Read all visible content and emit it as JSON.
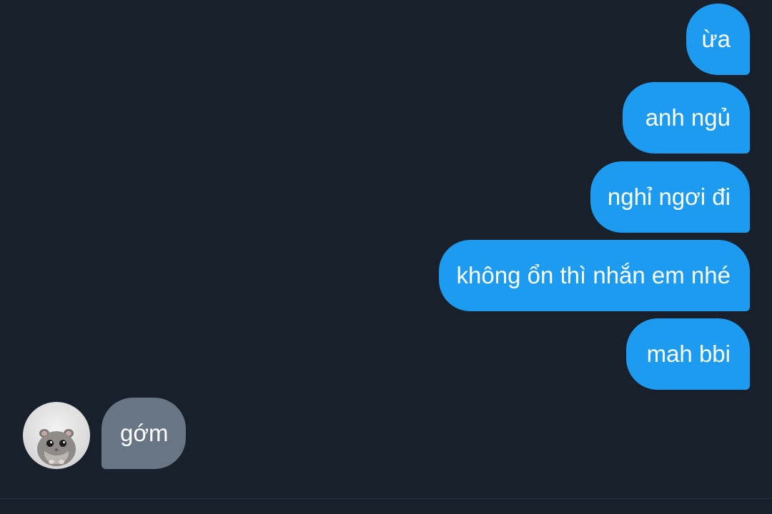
{
  "conversation": {
    "outgoing": [
      {
        "text": "ừa"
      },
      {
        "text": "anh ngủ"
      },
      {
        "text": "nghỉ ngơi đi"
      },
      {
        "text": "không ổn thì nhắn em nhé"
      },
      {
        "text": "mah bbi"
      }
    ],
    "incoming": [
      {
        "text": "gớm"
      }
    ]
  },
  "colors": {
    "background": "#18202b",
    "outgoing_bubble": "#1d9bf0",
    "incoming_bubble": "#687585",
    "text": "#ffffff"
  },
  "icons": {
    "avatar": "hamster-avatar-icon"
  }
}
